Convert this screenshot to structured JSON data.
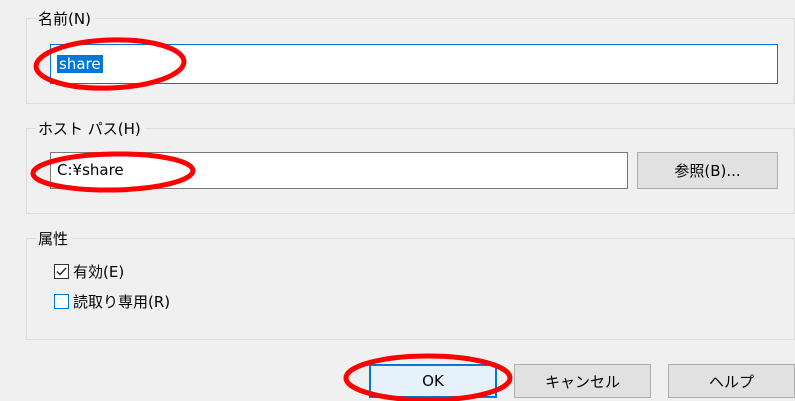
{
  "name_group": {
    "label": "名前(N)",
    "value": "share"
  },
  "host_path_group": {
    "label": "ホスト パス(H)",
    "value": "C:¥share",
    "browse_label": "参照(B)..."
  },
  "attributes_group": {
    "label": "属性",
    "enabled": {
      "label": "有効(E)",
      "checked": true
    },
    "read_only": {
      "label": "読取り専用(R)",
      "checked": false
    }
  },
  "buttons": {
    "ok_label": "OK",
    "cancel_label": "キャンセル",
    "help_label": "ヘルプ"
  },
  "colors": {
    "accent": "#0078d7",
    "annotation": "#ff0000",
    "background": "#f0f0f0"
  }
}
